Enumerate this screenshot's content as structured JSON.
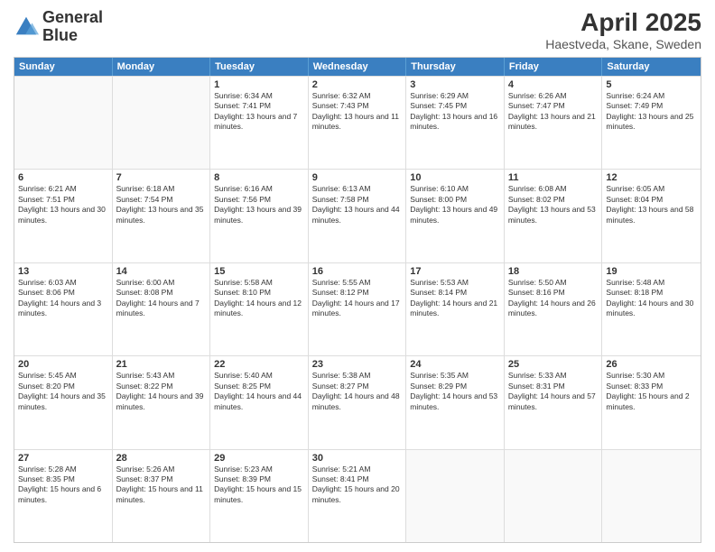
{
  "header": {
    "logo_line1": "General",
    "logo_line2": "Blue",
    "title": "April 2025",
    "subtitle": "Haestveda, Skane, Sweden"
  },
  "weekdays": [
    "Sunday",
    "Monday",
    "Tuesday",
    "Wednesday",
    "Thursday",
    "Friday",
    "Saturday"
  ],
  "rows": [
    [
      {
        "day": "",
        "info": ""
      },
      {
        "day": "",
        "info": ""
      },
      {
        "day": "1",
        "info": "Sunrise: 6:34 AM\nSunset: 7:41 PM\nDaylight: 13 hours and 7 minutes."
      },
      {
        "day": "2",
        "info": "Sunrise: 6:32 AM\nSunset: 7:43 PM\nDaylight: 13 hours and 11 minutes."
      },
      {
        "day": "3",
        "info": "Sunrise: 6:29 AM\nSunset: 7:45 PM\nDaylight: 13 hours and 16 minutes."
      },
      {
        "day": "4",
        "info": "Sunrise: 6:26 AM\nSunset: 7:47 PM\nDaylight: 13 hours and 21 minutes."
      },
      {
        "day": "5",
        "info": "Sunrise: 6:24 AM\nSunset: 7:49 PM\nDaylight: 13 hours and 25 minutes."
      }
    ],
    [
      {
        "day": "6",
        "info": "Sunrise: 6:21 AM\nSunset: 7:51 PM\nDaylight: 13 hours and 30 minutes."
      },
      {
        "day": "7",
        "info": "Sunrise: 6:18 AM\nSunset: 7:54 PM\nDaylight: 13 hours and 35 minutes."
      },
      {
        "day": "8",
        "info": "Sunrise: 6:16 AM\nSunset: 7:56 PM\nDaylight: 13 hours and 39 minutes."
      },
      {
        "day": "9",
        "info": "Sunrise: 6:13 AM\nSunset: 7:58 PM\nDaylight: 13 hours and 44 minutes."
      },
      {
        "day": "10",
        "info": "Sunrise: 6:10 AM\nSunset: 8:00 PM\nDaylight: 13 hours and 49 minutes."
      },
      {
        "day": "11",
        "info": "Sunrise: 6:08 AM\nSunset: 8:02 PM\nDaylight: 13 hours and 53 minutes."
      },
      {
        "day": "12",
        "info": "Sunrise: 6:05 AM\nSunset: 8:04 PM\nDaylight: 13 hours and 58 minutes."
      }
    ],
    [
      {
        "day": "13",
        "info": "Sunrise: 6:03 AM\nSunset: 8:06 PM\nDaylight: 14 hours and 3 minutes."
      },
      {
        "day": "14",
        "info": "Sunrise: 6:00 AM\nSunset: 8:08 PM\nDaylight: 14 hours and 7 minutes."
      },
      {
        "day": "15",
        "info": "Sunrise: 5:58 AM\nSunset: 8:10 PM\nDaylight: 14 hours and 12 minutes."
      },
      {
        "day": "16",
        "info": "Sunrise: 5:55 AM\nSunset: 8:12 PM\nDaylight: 14 hours and 17 minutes."
      },
      {
        "day": "17",
        "info": "Sunrise: 5:53 AM\nSunset: 8:14 PM\nDaylight: 14 hours and 21 minutes."
      },
      {
        "day": "18",
        "info": "Sunrise: 5:50 AM\nSunset: 8:16 PM\nDaylight: 14 hours and 26 minutes."
      },
      {
        "day": "19",
        "info": "Sunrise: 5:48 AM\nSunset: 8:18 PM\nDaylight: 14 hours and 30 minutes."
      }
    ],
    [
      {
        "day": "20",
        "info": "Sunrise: 5:45 AM\nSunset: 8:20 PM\nDaylight: 14 hours and 35 minutes."
      },
      {
        "day": "21",
        "info": "Sunrise: 5:43 AM\nSunset: 8:22 PM\nDaylight: 14 hours and 39 minutes."
      },
      {
        "day": "22",
        "info": "Sunrise: 5:40 AM\nSunset: 8:25 PM\nDaylight: 14 hours and 44 minutes."
      },
      {
        "day": "23",
        "info": "Sunrise: 5:38 AM\nSunset: 8:27 PM\nDaylight: 14 hours and 48 minutes."
      },
      {
        "day": "24",
        "info": "Sunrise: 5:35 AM\nSunset: 8:29 PM\nDaylight: 14 hours and 53 minutes."
      },
      {
        "day": "25",
        "info": "Sunrise: 5:33 AM\nSunset: 8:31 PM\nDaylight: 14 hours and 57 minutes."
      },
      {
        "day": "26",
        "info": "Sunrise: 5:30 AM\nSunset: 8:33 PM\nDaylight: 15 hours and 2 minutes."
      }
    ],
    [
      {
        "day": "27",
        "info": "Sunrise: 5:28 AM\nSunset: 8:35 PM\nDaylight: 15 hours and 6 minutes."
      },
      {
        "day": "28",
        "info": "Sunrise: 5:26 AM\nSunset: 8:37 PM\nDaylight: 15 hours and 11 minutes."
      },
      {
        "day": "29",
        "info": "Sunrise: 5:23 AM\nSunset: 8:39 PM\nDaylight: 15 hours and 15 minutes."
      },
      {
        "day": "30",
        "info": "Sunrise: 5:21 AM\nSunset: 8:41 PM\nDaylight: 15 hours and 20 minutes."
      },
      {
        "day": "",
        "info": ""
      },
      {
        "day": "",
        "info": ""
      },
      {
        "day": "",
        "info": ""
      }
    ]
  ]
}
